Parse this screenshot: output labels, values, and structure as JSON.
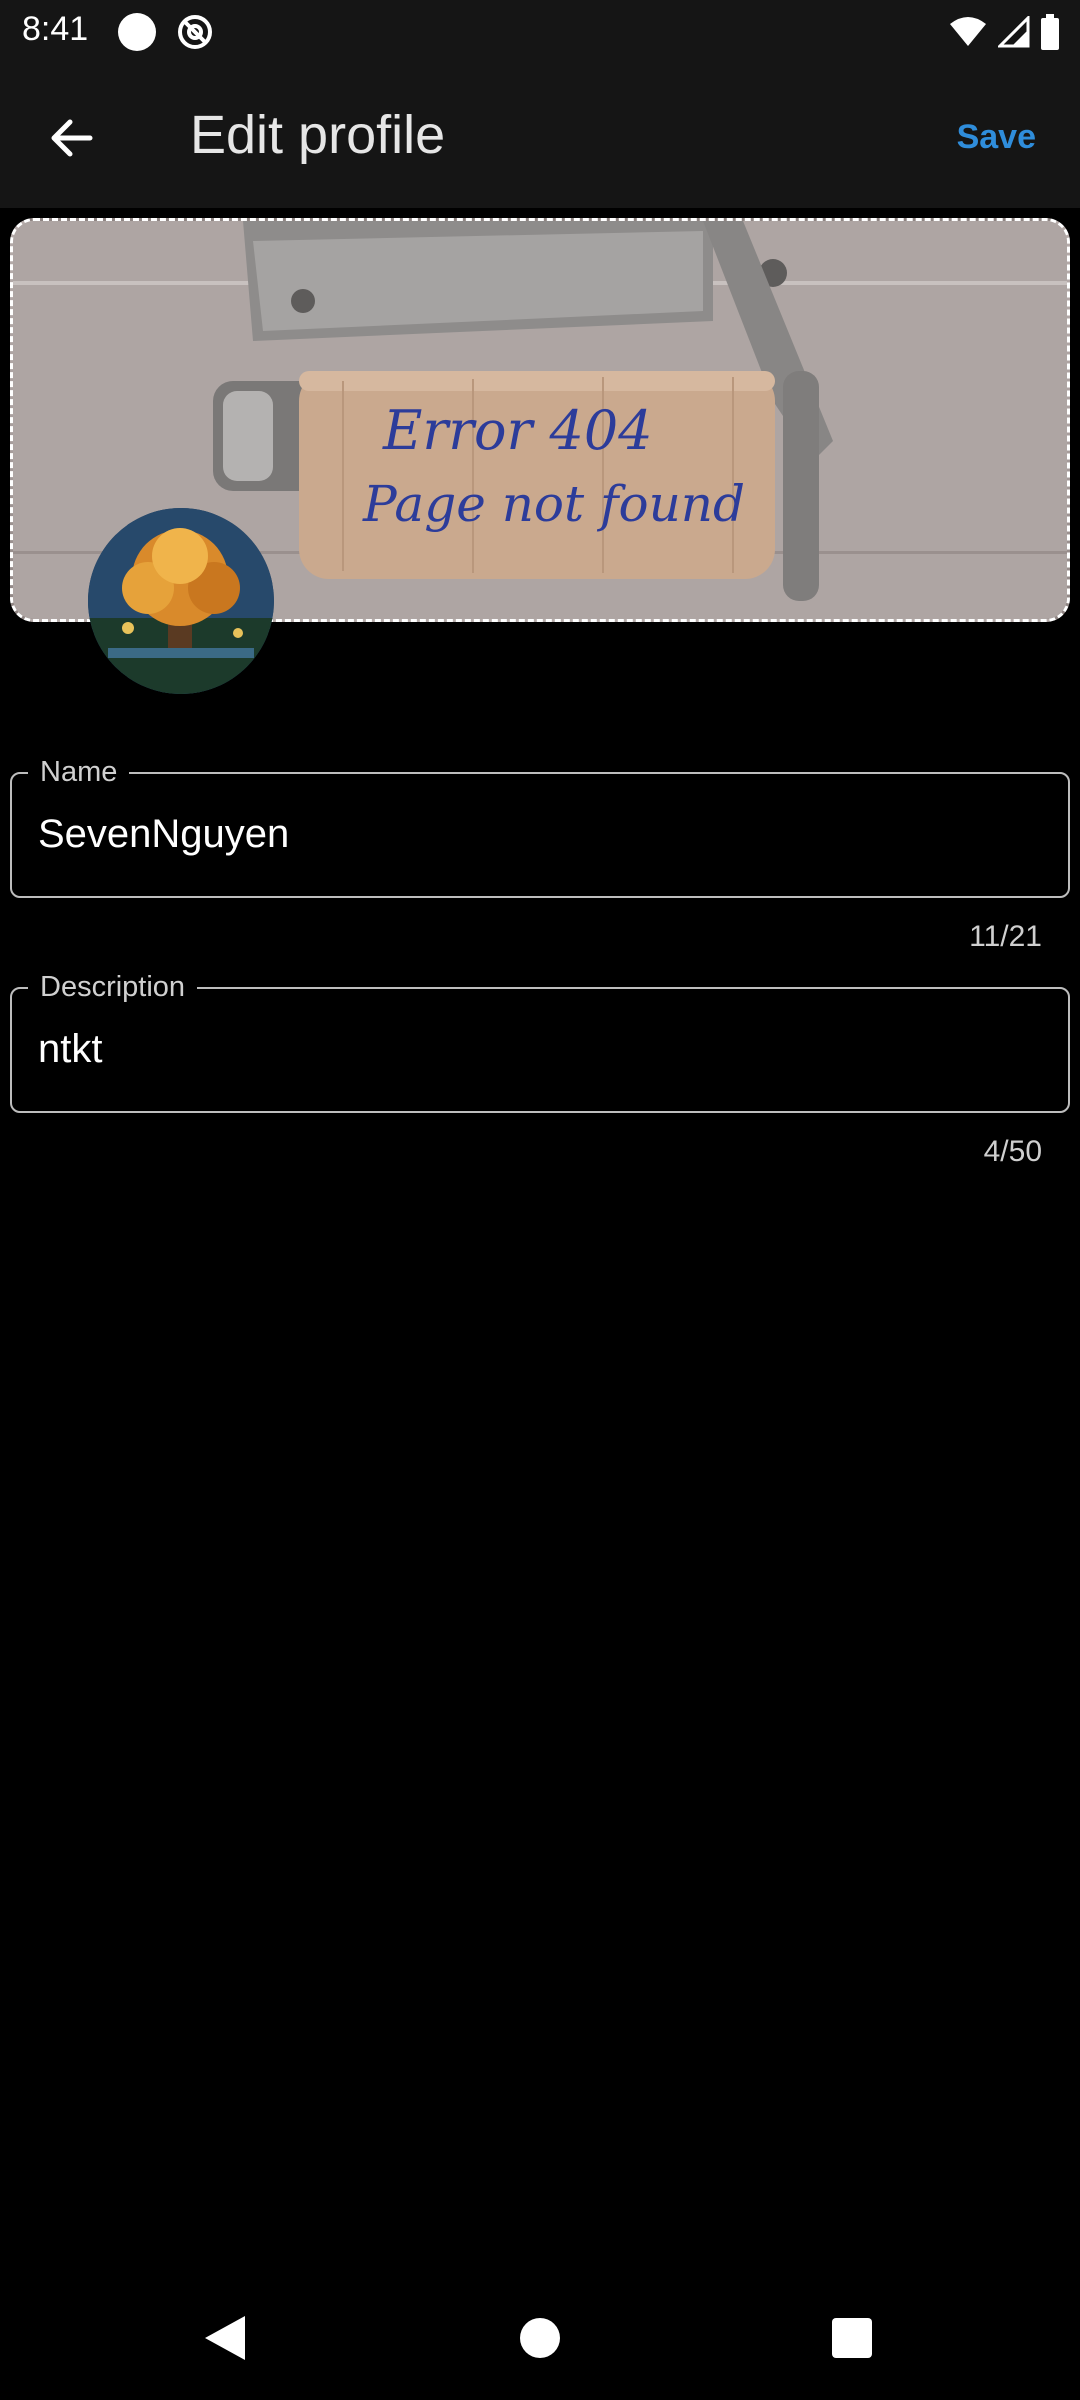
{
  "status_bar": {
    "time": "8:41",
    "icons": [
      "circle-icon",
      "do-not-disturb-icon",
      "wifi-icon",
      "signal-icon",
      "battery-icon"
    ]
  },
  "app_bar": {
    "title": "Edit profile",
    "save_label": "Save",
    "back_icon": "arrow-back-icon"
  },
  "cover": {
    "handwritten_text_line1": "Error 404",
    "handwritten_text_line2": "Page not found"
  },
  "form": {
    "name": {
      "label": "Name",
      "value": "SevenNguyen",
      "counter": "11/21"
    },
    "description": {
      "label": "Description",
      "value": "ntkt",
      "counter": "4/50"
    }
  },
  "colors": {
    "accent": "#2f8ddb",
    "background": "#000000",
    "app_bar": "#151515"
  },
  "nav_bar": {
    "icons": [
      "nav-back-icon",
      "nav-home-icon",
      "nav-recents-icon"
    ]
  }
}
